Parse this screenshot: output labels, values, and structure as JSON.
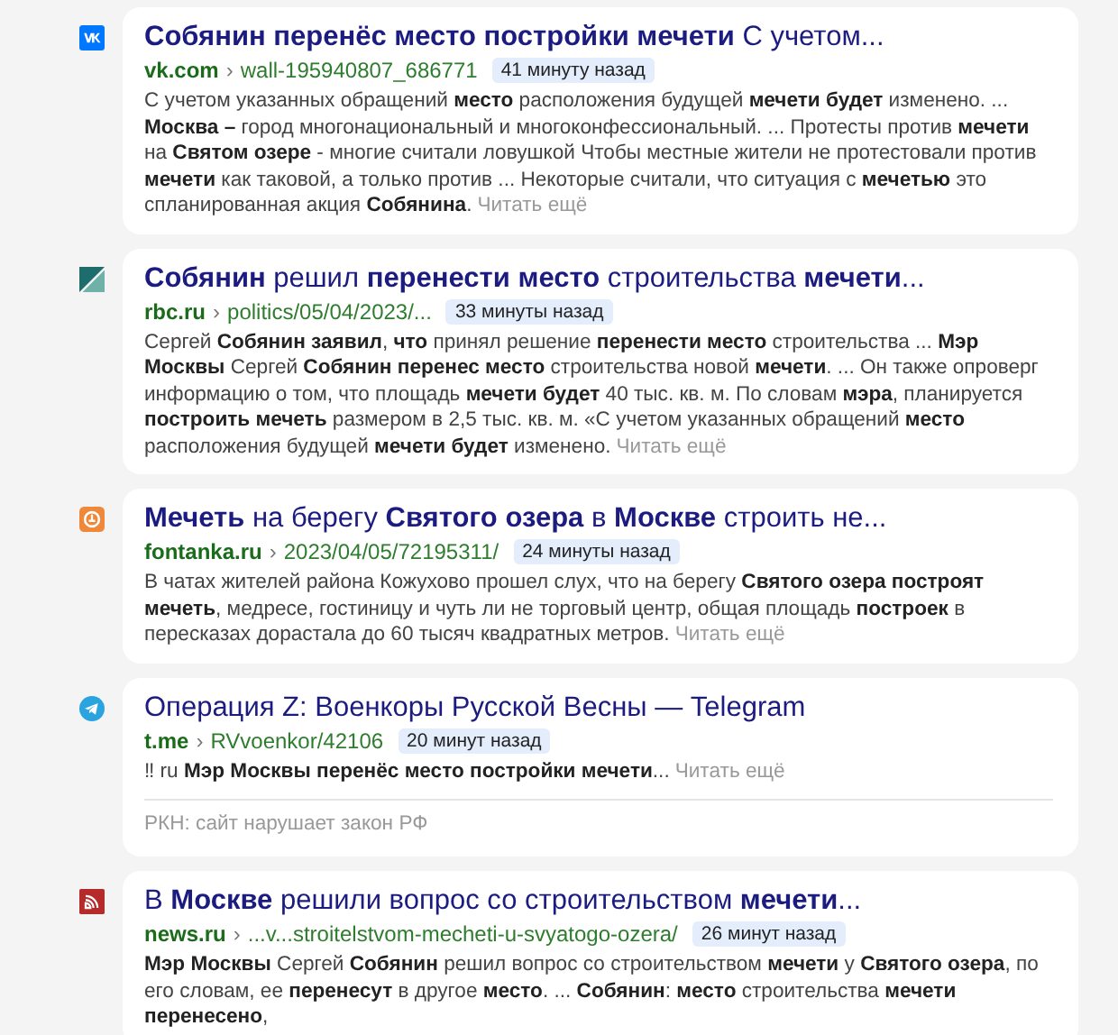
{
  "results": [
    {
      "kind": "vk",
      "title": "**Собянин перенёс место постройки мечети** С учетом...",
      "domain": "vk.com",
      "separator": "›",
      "path": "wall-195940807_686771",
      "time": "41 минуту назад",
      "snippet": "С учетом указанных обращений **место** расположения будущей **мечети будет** изменено. ... **Москва –** город многонациональный и многоконфессиональный. ... Протесты против **мечети** на **Святом озере** - многие считали ловушкой Чтобы местные жители не протестовали против **мечети** как таковой, а только против ... Некоторые считали, что ситуация с **мечетью** это спланированная акция **Собянина**.",
      "more": "Читать ещё"
    },
    {
      "kind": "rbc",
      "title": "**Собянин** решил **перенести место** строительства **мечети**...",
      "domain": "rbc.ru",
      "separator": "›",
      "path": "politics/05/04/2023/...",
      "time": "33 минуты назад",
      "snippet": "Сергей **Собянин заявил**, **что** принял решение **перенести место** строительства ... **Мэр Москвы** Сергей **Собянин перенес место** строительства новой **мечети**. ... Он также опроверг информацию о том, что площадь **мечети будет** 40 тыс. кв. м. По словам **мэра**, планируется **построить мечеть** размером в 2,5 тыс. кв. м. «С учетом указанных обращений **место** расположения будущей **мечети будет** изменено.",
      "more": "Читать ещё"
    },
    {
      "kind": "fontanka",
      "title": "**Мечеть** на берегу **Святого озера** в **Москве** строить не...",
      "domain": "fontanka.ru",
      "separator": "›",
      "path": "2023/04/05/72195311/",
      "time": "24 минуты назад",
      "snippet": "В чатах жителей района Кожухово прошел слух, что на берегу **Святого озера построят мечеть**, медресе, гостиницу и чуть ли не торговый центр, общая площадь **построек** в пересказах дорастала до 60 тысяч квадратных метров.",
      "more": "Читать ещё"
    },
    {
      "kind": "telegram",
      "title": "Операция Z: Военкоры Русской Весны — Telegram",
      "domain": "t.me",
      "separator": "›",
      "path": "RVvoenkor/42106",
      "time": "20 минут назад",
      "snippet": "‼ ru **Мэр Москвы перенёс место постройки мечети**...",
      "more": "Читать ещё",
      "notice": "РКН: сайт нарушает закон РФ"
    },
    {
      "kind": "newsru",
      "title": "В **Москве** решили вопрос со строительством **мечети**...",
      "domain": "news.ru",
      "separator": "›",
      "path": "...v...stroitelstvom-mecheti-u-svyatogo-ozera/",
      "time": "26 минут назад",
      "snippet": "**Мэр Москвы** Сергей **Собянин** решил вопрос со строительством **мечети** у **Святого озера**, по его словам, ее **перенесут** в другое **место**. ... **Собянин**: **место** строительства **мечети перенесено**,"
    }
  ]
}
